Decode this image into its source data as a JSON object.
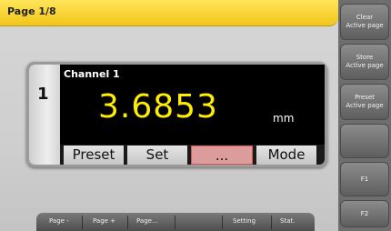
{
  "header": {
    "title": "Page 1/8"
  },
  "softkeys": [
    {
      "label": "Clear\nActive page"
    },
    {
      "label": "Store\nActive page"
    },
    {
      "label": "Preset\nActive page"
    },
    {
      "label": ""
    },
    {
      "label": "F1"
    },
    {
      "label": "F2"
    }
  ],
  "channel": {
    "number": "1",
    "label": "Channel 1",
    "value": "3.6853",
    "unit": "mm"
  },
  "function_buttons": [
    {
      "label": "Preset"
    },
    {
      "label": "Set"
    },
    {
      "label": "..."
    },
    {
      "label": "Mode"
    }
  ],
  "tabs": [
    {
      "label": "Page -"
    },
    {
      "label": "Page +"
    },
    {
      "label": "Page..."
    },
    {
      "label": ""
    },
    {
      "label": "Setting"
    },
    {
      "label": "Stat."
    }
  ],
  "colors": {
    "header": "#f2c51a",
    "value": "#ffee00",
    "active_button": "#dd9c9c"
  }
}
